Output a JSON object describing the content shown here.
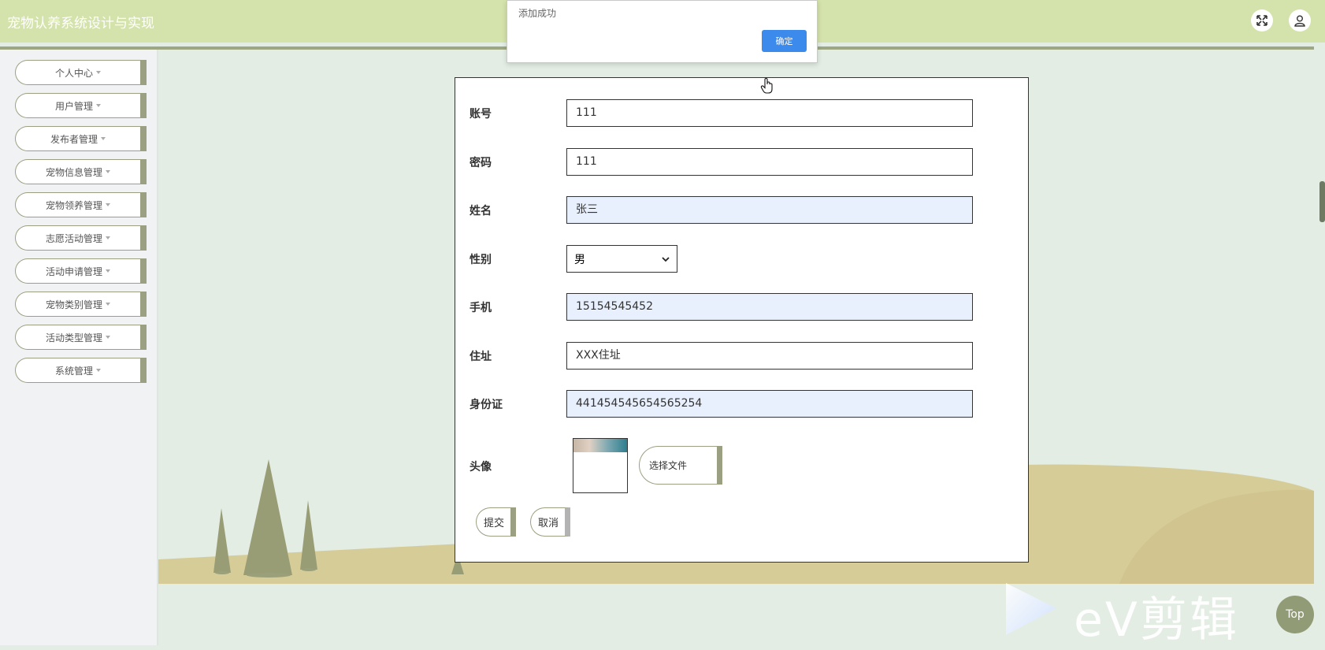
{
  "app": {
    "title": "宠物认养系统设计与实现"
  },
  "header": {
    "fullscreen_icon": "expand-arrows-icon",
    "user_icon": "user-icon"
  },
  "sidebar": {
    "items": [
      {
        "label": "个人中心"
      },
      {
        "label": "用户管理"
      },
      {
        "label": "发布者管理"
      },
      {
        "label": "宠物信息管理"
      },
      {
        "label": "宠物领养管理"
      },
      {
        "label": "志愿活动管理"
      },
      {
        "label": "活动申请管理"
      },
      {
        "label": "宠物类别管理"
      },
      {
        "label": "活动类型管理"
      },
      {
        "label": "系统管理"
      }
    ]
  },
  "form": {
    "account": {
      "label": "账号",
      "value": "111"
    },
    "password": {
      "label": "密码",
      "value": "111"
    },
    "name": {
      "label": "姓名",
      "value": "张三"
    },
    "gender": {
      "label": "性别",
      "value": "男"
    },
    "phone": {
      "label": "手机",
      "value": "15154545452"
    },
    "address": {
      "label": "住址",
      "value": "XXX住址"
    },
    "id_card": {
      "label": "身份证",
      "value": "441454545654565254"
    },
    "avatar": {
      "label": "头像",
      "choose_file_label": "选择文件"
    },
    "submit_label": "提交",
    "cancel_label": "取消"
  },
  "dialog": {
    "message": "添加成功",
    "ok_label": "确定"
  },
  "watermark": {
    "text": "eV剪辑"
  },
  "top_button": {
    "label": "Top"
  },
  "colors": {
    "header": "#d4e2ab",
    "accent": "#9aa081",
    "primary_button": "#3b8aec",
    "background": "#e3ede4"
  }
}
